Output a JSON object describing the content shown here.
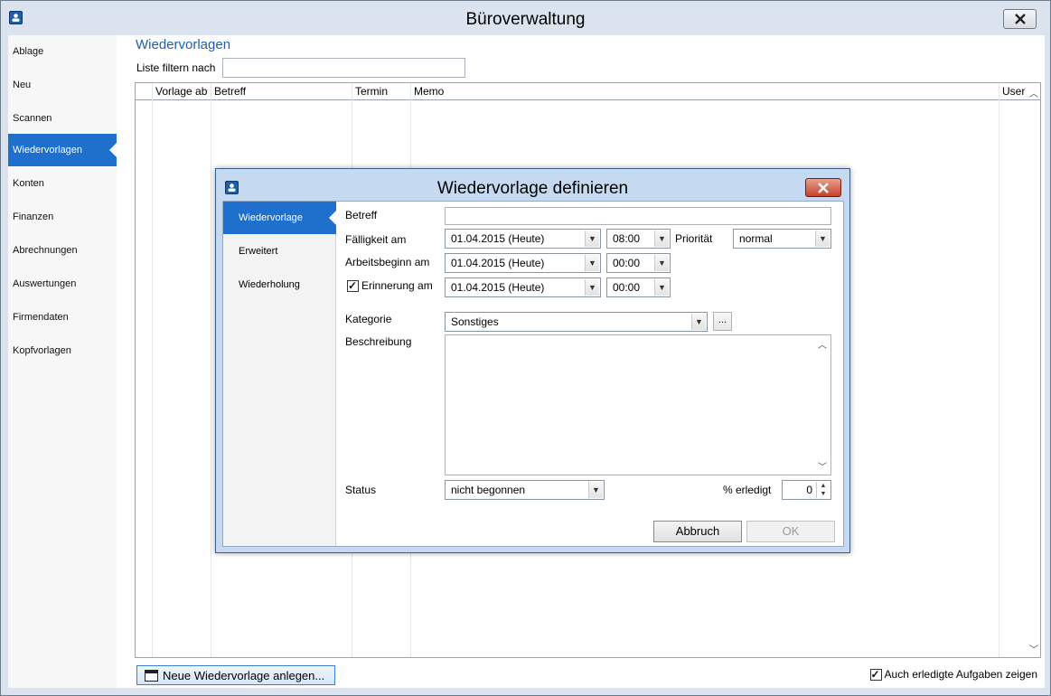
{
  "window": {
    "title": "Büroverwaltung"
  },
  "sidebar": {
    "items": [
      {
        "label": "Ablage"
      },
      {
        "label": "Neu"
      },
      {
        "label": "Scannen"
      },
      {
        "label": "Wiedervorlagen",
        "active": true
      },
      {
        "label": "Konten"
      },
      {
        "label": "Finanzen"
      },
      {
        "label": "Abrechnungen"
      },
      {
        "label": "Auswertungen"
      },
      {
        "label": "Firmendaten"
      },
      {
        "label": "Kopfvorlagen"
      }
    ]
  },
  "main": {
    "title": "Wiedervorlagen",
    "filter_label": "Liste filtern nach",
    "filter_value": "",
    "columns": [
      "Vorlage ab",
      "Betreff",
      "Termin",
      "Memo",
      "User"
    ],
    "new_button": "Neue Wiedervorlage anlegen...",
    "show_done_label": "Auch erledigte Aufgaben zeigen",
    "show_done_checked": true
  },
  "dialog": {
    "title": "Wiedervorlage definieren",
    "tabs": [
      {
        "label": "Wiedervorlage",
        "active": true
      },
      {
        "label": "Erweitert"
      },
      {
        "label": "Wiederholung"
      }
    ],
    "betreff_label": "Betreff",
    "betreff_value": "",
    "faelligkeit_label": "Fälligkeit am",
    "faelligkeit_date": "01.04.2015 (Heute)",
    "faelligkeit_time": "08:00",
    "prioritaet_label": "Priorität",
    "prioritaet_value": "normal",
    "arbeitsbeginn_label": "Arbeitsbeginn am",
    "arbeitsbeginn_date": "01.04.2015 (Heute)",
    "arbeitsbeginn_time": "00:00",
    "erinnerung_label": "Erinnerung am",
    "erinnerung_checked": true,
    "erinnerung_date": "01.04.2015 (Heute)",
    "erinnerung_time": "00:00",
    "kategorie_label": "Kategorie",
    "kategorie_value": "Sonstiges",
    "kategorie_more": "...",
    "beschreibung_label": "Beschreibung",
    "beschreibung_value": "",
    "status_label": "Status",
    "status_value": "nicht begonnen",
    "erledigt_label": "% erledigt",
    "erledigt_value": "0",
    "cancel_button": "Abbruch",
    "ok_button": "OK"
  },
  "colors": {
    "accent": "#1f6fcc",
    "title_blue": "#1c5fb4",
    "close_red": "#c5422b"
  }
}
